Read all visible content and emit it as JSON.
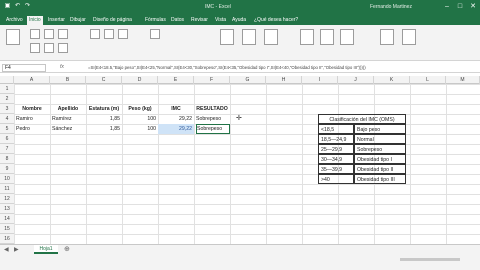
{
  "titlebar": {
    "title": "IMC - Excel",
    "user": "Fernando Martinez"
  },
  "tabs": [
    "Archivo",
    "Inicio",
    "Insertar",
    "Dibujar",
    "Diseño de página",
    "Fórmulas",
    "Datos",
    "Revisar",
    "Vista",
    "Ayuda",
    "¿Qué desea hacer?"
  ],
  "namebox": "F4",
  "formula": "=SI(E4<18.5,\"Bajo peso\",SI(E4<25,\"Normal\",SI(E4<30,\"Sobrepeso\",SI(E4<35,\"Obesidad tipo I\",SI(E4<40,\"Obesidad tipo II\",\"Obesidad tipo III\")))))",
  "columns": [
    "A",
    "B",
    "C",
    "D",
    "E",
    "F",
    "G",
    "H",
    "I",
    "J",
    "K",
    "L",
    "M"
  ],
  "rows": [
    "1",
    "2",
    "3",
    "4",
    "5",
    "6",
    "7",
    "8",
    "9",
    "10",
    "11",
    "12",
    "13",
    "14",
    "15",
    "16"
  ],
  "table": {
    "headers": [
      "Nombre",
      "Apellido",
      "Estatura (m)",
      "Peso (kg)",
      "IMC",
      "RESULTADO"
    ],
    "rows": [
      [
        "Ramiro",
        "Ramírez",
        "1,85",
        "100",
        "29,22",
        "Sobrepeso"
      ],
      [
        "Pedro",
        "Sánchez",
        "1,85",
        "100",
        "29,22",
        "Sobrepeso"
      ]
    ]
  },
  "classification": {
    "title": "Clasificación del IMC (OMS)",
    "rows": [
      [
        "<18,5",
        "Bajo peso"
      ],
      [
        "18,5—24,9",
        "Normal"
      ],
      [
        "25—29,9",
        "Sobrepeso"
      ],
      [
        "30—34,9",
        "Obesidad tipo I"
      ],
      [
        "35—39,9",
        "Obesidad tipo II"
      ],
      [
        ">40",
        "Obesidad tipo III"
      ]
    ]
  },
  "sheet_tab": "Hoja1",
  "colors": {
    "accent": "#217346"
  }
}
